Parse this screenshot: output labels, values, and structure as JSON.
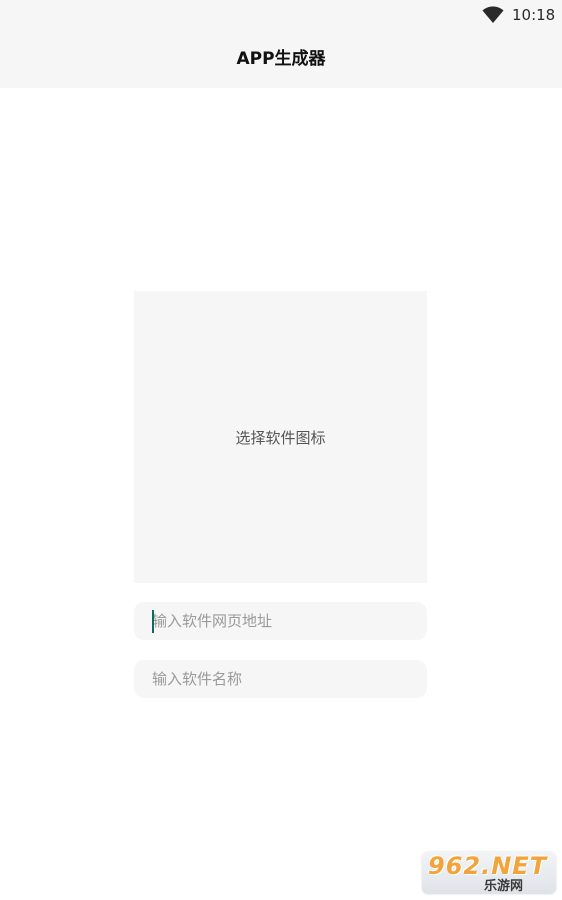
{
  "status_bar": {
    "time": "10:18",
    "wifi_icon": "wifi-icon"
  },
  "app_bar": {
    "title": "APP生成器"
  },
  "icon_picker": {
    "label": "选择软件图标"
  },
  "form": {
    "url_placeholder": "输入软件网页地址",
    "url_value": "",
    "name_placeholder": "输入软件名称",
    "name_value": ""
  },
  "watermark": {
    "brand": "962.NET",
    "subtitle": "乐游网"
  },
  "colors": {
    "bar_background": "#f6f6f6",
    "field_background": "#f6f6f6",
    "cursor": "#0a6b5e",
    "watermark_accent": "#f2a33a"
  }
}
